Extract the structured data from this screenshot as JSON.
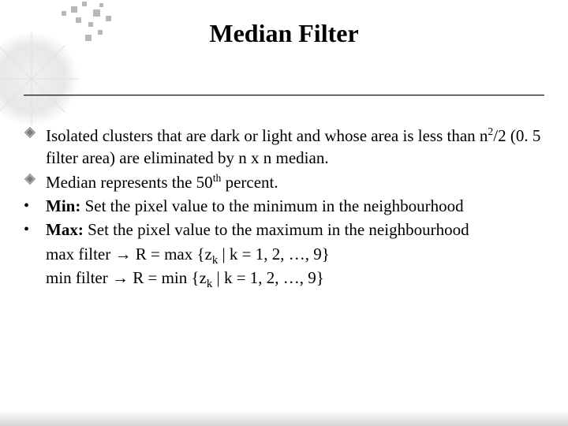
{
  "title": "Median Filter",
  "body": {
    "bullet1_a": "Isolated clusters that are dark or light and whose area is less than n",
    "bullet1_sup": "2",
    "bullet1_b": "/2 (0. 5 filter area) are eliminated by n x n median.",
    "bullet2_a": "Median represents the 50",
    "bullet2_sup": "th",
    "bullet2_b": " percent.",
    "bullet3_label": "Min:",
    "bullet3_text": " Set the pixel value to the minimum in the neighbourhood",
    "bullet4_label": "Max:",
    "bullet4_text": " Set the pixel value to the maximum in the neighbourhood",
    "line5_a": "max filter → R = max {z",
    "line5_sub": "k",
    "line5_b": " | k = 1, 2, …, 9}",
    "line6_a": "min filter → R = min {z",
    "line6_sub": "k",
    "line6_b": " | k = 1, 2, …, 9}"
  }
}
